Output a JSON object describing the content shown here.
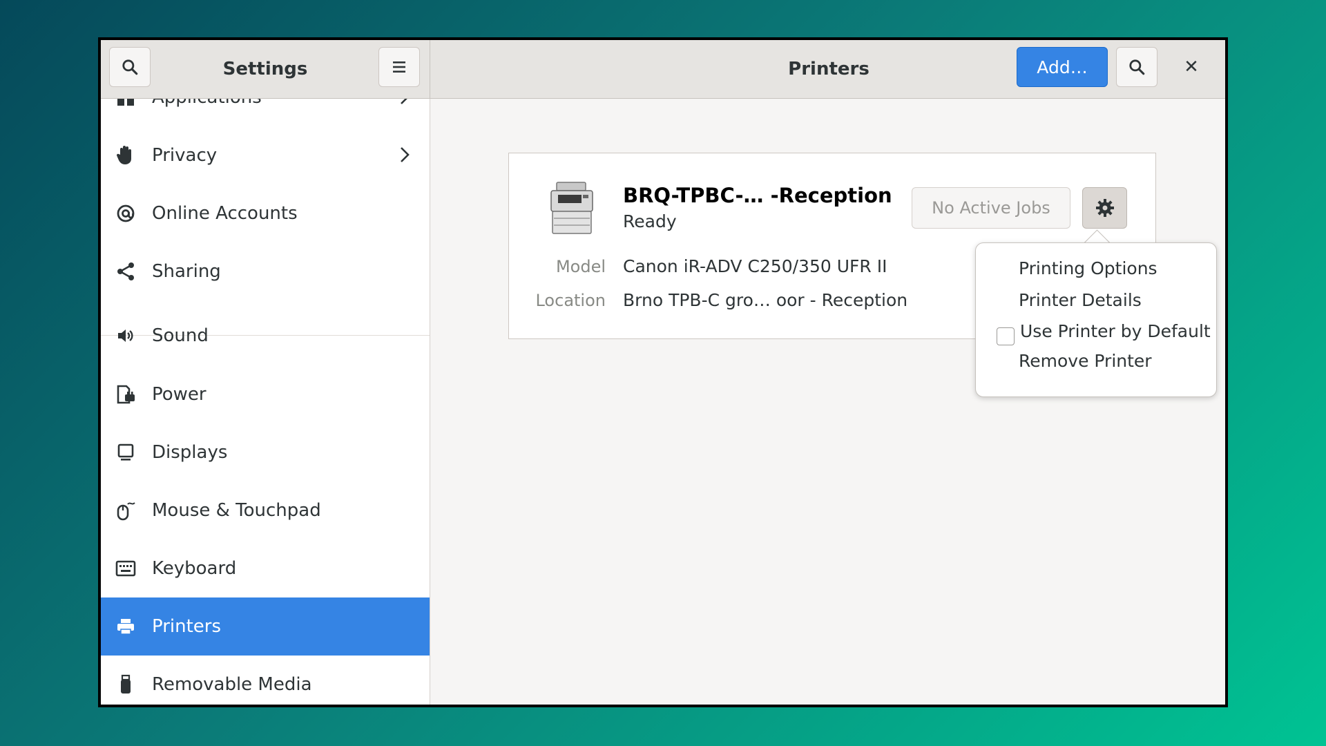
{
  "header": {
    "sidebar_title": "Settings",
    "page_title": "Printers",
    "add_label": "Add…",
    "close_glyph": "✕"
  },
  "sidebar": {
    "items": [
      {
        "label": "Applications",
        "icon": "apps-icon"
      },
      {
        "label": "Privacy",
        "icon": "hand-icon"
      },
      {
        "label": "Online Accounts",
        "icon": "at-icon"
      },
      {
        "label": "Sharing",
        "icon": "share-icon"
      },
      {
        "label": "Sound",
        "icon": "speaker-icon"
      },
      {
        "label": "Power",
        "icon": "power-icon"
      },
      {
        "label": "Displays",
        "icon": "display-icon"
      },
      {
        "label": "Mouse & Touchpad",
        "icon": "mouse-icon"
      },
      {
        "label": "Keyboard",
        "icon": "keyboard-icon"
      },
      {
        "label": "Printers",
        "icon": "printer-icon"
      },
      {
        "label": "Removable Media",
        "icon": "usb-icon"
      }
    ],
    "selected": "Printers"
  },
  "printer": {
    "name": "BRQ-TPBC-…  -Reception",
    "status": "Ready",
    "model_label": "Model",
    "model_value": "Canon iR-ADV C250/350 UFR II",
    "location_label": "Location",
    "location_value": "Brno TPB-C gro… oor - Reception",
    "jobs_label": "No Active Jobs"
  },
  "popover": {
    "items": [
      "Printing Options",
      "Printer Details",
      "Use Printer by Default",
      "Remove Printer"
    ],
    "default_checked": false
  },
  "colors": {
    "accent": "#3584e4",
    "background_start": "#05495a",
    "background_end": "#00c393"
  }
}
